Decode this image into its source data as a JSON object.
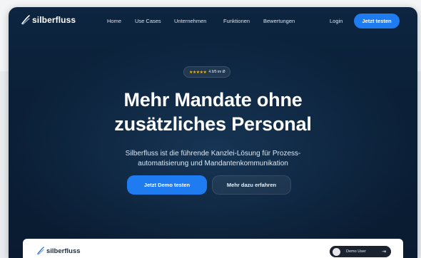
{
  "nav": {
    "brand": "silberfluss",
    "links": [
      "Home",
      "Use Cases",
      "Unternehmen",
      "Funktionen",
      "Bewertungen"
    ],
    "login": "Login",
    "cta": "Jetzt testen"
  },
  "hero": {
    "rating_stars": "★★★★★",
    "rating_text": "4.9/5 im Ø",
    "headline_line1": "Mehr Mandate ohne",
    "headline_line2": "zusätzliches Personal",
    "sub_line1": "Silberfluss ist die führende Kanzlei-Lösung für Prozess-",
    "sub_line2": "automatisierung und Mandantenkommunikation",
    "primary_button": "Jetzt Demo testen",
    "secondary_button": "Mehr dazu erfahren"
  },
  "preview": {
    "brand": "silberfluss",
    "user": "Demo User"
  },
  "colors": {
    "accent": "#1f7cf0",
    "background": "#0b2038",
    "star": "#f5b50a"
  },
  "icons": [
    "logo-swoosh-icon",
    "star-icon",
    "avatar-icon",
    "logout-icon"
  ]
}
